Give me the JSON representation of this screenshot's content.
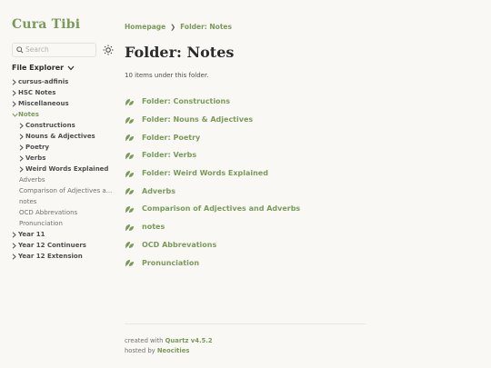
{
  "site": {
    "title": "Cura Tibi"
  },
  "search": {
    "placeholder": "Search"
  },
  "explorer": {
    "title": "File Explorer",
    "items": [
      {
        "label": "cursus-adfinis",
        "kind": "folder",
        "depth": 0,
        "open": false
      },
      {
        "label": "HSC Notes",
        "kind": "folder",
        "depth": 0,
        "open": false
      },
      {
        "label": "Miscellaneous",
        "kind": "folder",
        "depth": 0,
        "open": false
      },
      {
        "label": "Notes",
        "kind": "folder",
        "depth": 0,
        "open": true
      },
      {
        "label": "Constructions",
        "kind": "folder",
        "depth": 1,
        "open": false
      },
      {
        "label": "Nouns & Adjectives",
        "kind": "folder",
        "depth": 1,
        "open": false
      },
      {
        "label": "Poetry",
        "kind": "folder",
        "depth": 1,
        "open": false
      },
      {
        "label": "Verbs",
        "kind": "folder",
        "depth": 1,
        "open": false
      },
      {
        "label": "Weird Words Explained",
        "kind": "folder",
        "depth": 1,
        "open": false
      },
      {
        "label": "Adverbs",
        "kind": "file",
        "depth": 1
      },
      {
        "label": "Comparison of Adjectives a...",
        "kind": "file",
        "depth": 1
      },
      {
        "label": "notes",
        "kind": "file",
        "depth": 1
      },
      {
        "label": "OCD Abbrevations",
        "kind": "file",
        "depth": 1
      },
      {
        "label": "Pronunciation",
        "kind": "file",
        "depth": 1
      },
      {
        "label": "Year 11",
        "kind": "folder",
        "depth": 0,
        "open": false
      },
      {
        "label": "Year 12 Continuers",
        "kind": "folder",
        "depth": 0,
        "open": false
      },
      {
        "label": "Year 12 Extension",
        "kind": "folder",
        "depth": 0,
        "open": false
      }
    ]
  },
  "breadcrumb": {
    "home": "Homepage",
    "current": "Folder: Notes"
  },
  "page": {
    "title": "Folder: Notes",
    "count_text": "10 items under this folder.",
    "items": [
      "Folder: Constructions",
      "Folder: Nouns & Adjectives",
      "Folder: Poetry",
      "Folder: Verbs",
      "Folder: Weird Words Explained",
      "Adverbs",
      "Comparison of Adjectives and Adverbs",
      "notes",
      "OCD Abbrevations",
      "Pronunciation"
    ]
  },
  "footer": {
    "created_prefix": "created with",
    "created_link": "Quartz v4.5.2",
    "hosted_prefix": "hosted by",
    "hosted_link": "Neocities"
  },
  "colors": {
    "accent": "#7a9a59",
    "text": "#2b2b2b",
    "background": "#f9f8f5"
  },
  "icons": {
    "search": "search-icon",
    "theme": "sun-icon",
    "explorer": "chevron-down-icon",
    "item": "leaf-icon"
  }
}
